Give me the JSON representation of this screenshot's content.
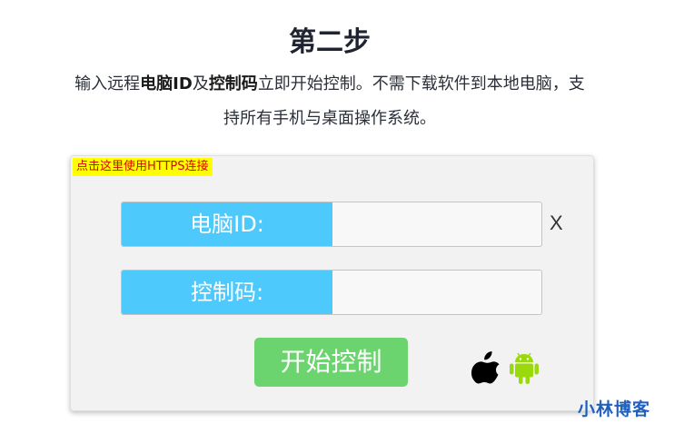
{
  "header": {
    "title": "第二步",
    "desc_part1": "输入远程",
    "desc_bold1": "电脑ID",
    "desc_part2": "及",
    "desc_bold2": "控制码",
    "desc_part3": "立即开始控制。不需下载软件到本地电脑，支持所有手机与桌面操作系统。"
  },
  "panel": {
    "https_link": "点击这里使用HTTPS连接",
    "computer_id_label": "电脑ID:",
    "computer_id_value": "",
    "control_code_label": "控制码:",
    "control_code_value": "",
    "clear_label": "X",
    "start_button": "开始控制",
    "icons": [
      "apple-icon",
      "android-icon"
    ]
  },
  "watermark": "小林博客",
  "colors": {
    "label_bg": "#4dc9fc",
    "button_bg": "#6bd46f",
    "link_bg": "#ffff00",
    "link_text": "#e00000",
    "android": "#9ad90b",
    "watermark": "#1f5fbf"
  }
}
